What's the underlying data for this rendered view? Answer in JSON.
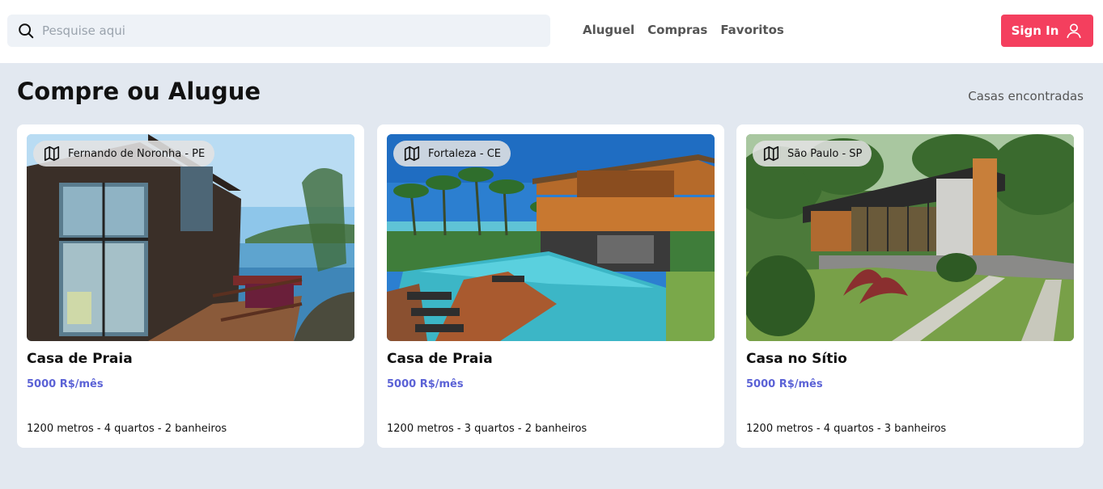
{
  "header": {
    "search": {
      "placeholder": "Pesquise aqui",
      "value": "",
      "icon": "search-icon"
    },
    "nav": [
      {
        "label": "Aluguel"
      },
      {
        "label": "Compras"
      },
      {
        "label": "Favoritos"
      }
    ],
    "signin": {
      "label": "Sign In",
      "icon": "user-icon",
      "color": "#f43f5e"
    }
  },
  "main": {
    "title": "Compre ou Alugue",
    "found_label": "Casas encontradas",
    "accent_color": "#5b62d6"
  },
  "listings": [
    {
      "location": "Fernando de Noronha - PE",
      "title": "Casa de Praia",
      "price": "5000 R$/mês",
      "specs": "1200 metros - 4 quartos - 2 banheiros"
    },
    {
      "location": "Fortaleza - CE",
      "title": "Casa de Praia",
      "price": "5000 R$/mês",
      "specs": "1200 metros - 3 quartos - 2 banheiros"
    },
    {
      "location": "São Paulo - SP",
      "title": "Casa no Sítio",
      "price": "5000 R$/mês",
      "specs": "1200 metros - 4 quartos - 3 banheiros"
    }
  ]
}
